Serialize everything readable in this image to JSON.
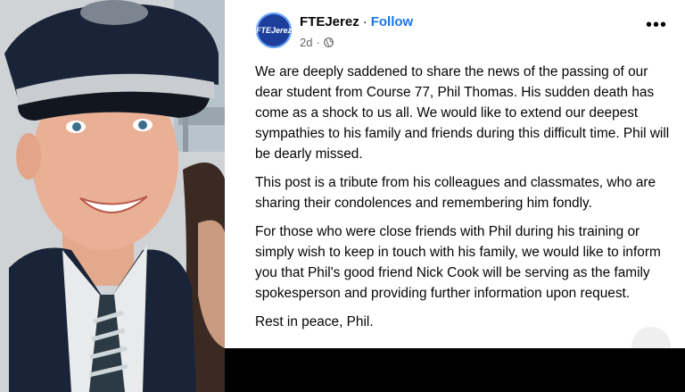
{
  "post": {
    "author": "FTEJerez",
    "follow_label": "Follow",
    "separator": "·",
    "time": "2d",
    "privacy_icon": "globe-icon",
    "avatar_text": "FTEJerez",
    "more_icon": "more-options-icon",
    "paragraphs": [
      "We are deeply saddened to share the news of the passing of our dear student from Course 77, Phil Thomas. His sudden death has come as a shock to us all. We would like to extend our deepest sympathies to his family and friends during this difficult time. Phil will be dearly missed.",
      "This post is a tribute from his colleagues and classmates, who are sharing their condolences and remembering him fondly.",
      "For those who were close friends with Phil during his training or simply wish to keep in touch with his family, we would like to inform you that Phil's good friend Nick Cook will be serving as the family spokesperson and providing further information upon request.",
      "Rest in peace, Phil."
    ]
  },
  "colors": {
    "follow_blue": "#1b74e4",
    "avatar_blue": "#1d3f9b",
    "uniform_navy": "#1a2438",
    "background_black": "#000000"
  }
}
